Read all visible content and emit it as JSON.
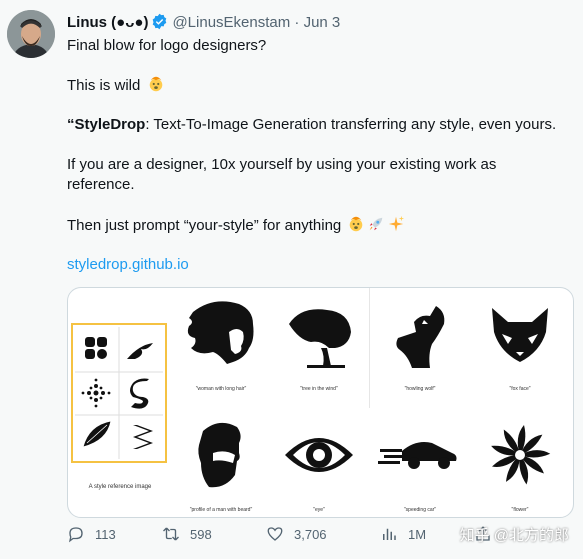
{
  "tweet": {
    "author_name": "Linus (●ᴗ●)",
    "handle": "@LinusEkenstam",
    "separator": "·",
    "date": "Jun 3",
    "lines": {
      "l1": "Final blow for logo designers?",
      "l2": "This is wild",
      "l3_bold": "“StyleDrop",
      "l3_rest": ": Text-To-Image Generation transferring any style, even yours.",
      "l4a": "If you are a designer, 10x yourself by using your existing work as",
      "l4b": "reference.",
      "l5": "Then just prompt “your-style” for anything",
      "link": "styledrop.github.io"
    }
  },
  "media": {
    "ref_caption": "A style reference image",
    "captions": [
      "\"woman with long hair\"",
      "\"tree in the wind\"",
      "\"howling wolf\"",
      "\"fox face\"",
      "\"profile of a man with beard\"",
      "\"eye\"",
      "\"speeding car\"",
      "\"flower\""
    ]
  },
  "actions": {
    "replies": "113",
    "retweets": "598",
    "likes": "3,706",
    "views": "1M"
  },
  "watermark": "知乎 @北方的郎",
  "colors": {
    "accent": "#1d9bf0",
    "muted": "#536471",
    "ref_border": "#f5c242"
  }
}
